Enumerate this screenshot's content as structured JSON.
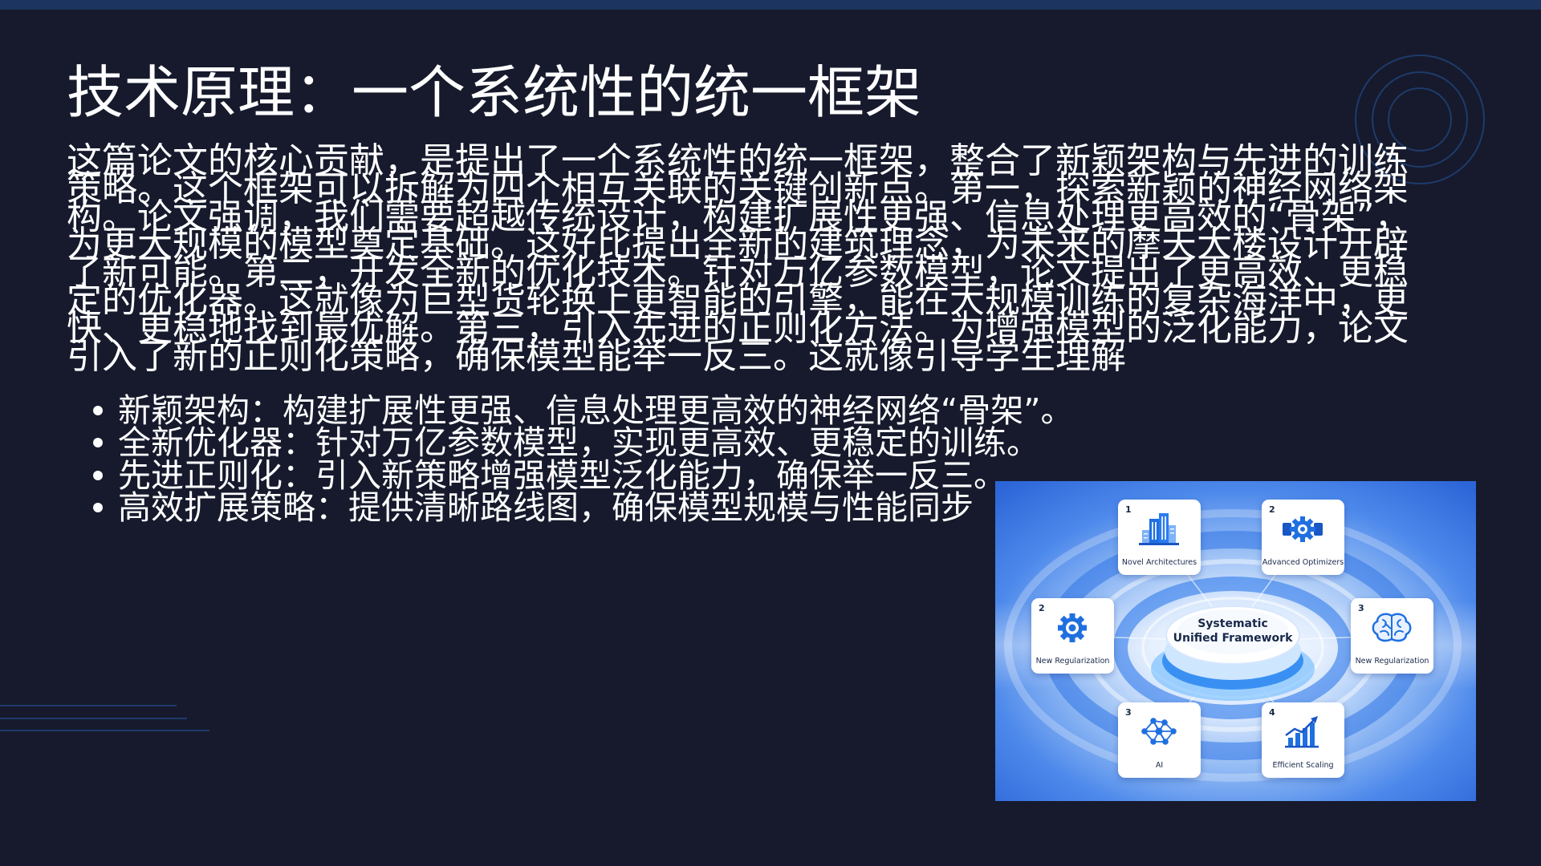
{
  "slide": {
    "title": "技术原理：一个系统性的统一框架",
    "paragraph": "这篇论文的核心贡献，是提出了一个系统性的统一框架，整合了新颖架构与先进的训练策略。这个框架可以拆解为四个相互关联的关键创新点。第一，探索新颖的神经网络架构。论文强调，我们需要超越传统设计，构建扩展性更强、信息处理更高效的“骨架”，为更大规模的模型奠定基础。这好比提出全新的建筑理念，为未来的摩天大楼设计开辟了新可能。第二，开发全新的优化技术。针对万亿参数模型，论文提出了更高效、更稳定的优化器。这就像为巨型货轮换上更智能的引擎，能在大规模训练的复杂海洋中，更快、更稳地找到最优解。第三，引入先进的正则化方法。为增强模型的泛化能力，论文引入了新的正则化策略，确保模型能举一反三。这就像引导学生理解",
    "bullets": [
      "新颖架构：构建扩展性更强、信息处理更高效的神经网络“骨架”。",
      "全新优化器：针对万亿参数模型，实现更高效、更稳定的训练。",
      "先进正则化：引入新策略增强模型泛化能力，确保举一反三。",
      "高效扩展策略：提供清晰路线图，确保模型规模与性能同步"
    ]
  },
  "figure": {
    "center_title_line1": "Systematic",
    "center_title_line2": "Unified Framework",
    "cards": [
      {
        "number": "1",
        "label": "Novel Architectures",
        "icon": "building-icon"
      },
      {
        "number": "2",
        "label": "Advanced Optimizers",
        "icon": "engine-gear-icon"
      },
      {
        "number": "2",
        "label": "New Regularization",
        "icon": "gear-icon"
      },
      {
        "number": "3",
        "label": "New Regularization",
        "icon": "brain-icon"
      },
      {
        "number": "3",
        "label": "AI",
        "icon": "network-icon"
      },
      {
        "number": "4",
        "label": "Efficient Scaling",
        "icon": "growth-chart-icon"
      }
    ]
  },
  "colors": {
    "background": "#161a2c",
    "top_bar": "#1c3560",
    "text": "#ffffff",
    "decor_line": "#1e3b6c",
    "figure_accent": "#1f6fe0",
    "figure_text": "#18284a"
  }
}
